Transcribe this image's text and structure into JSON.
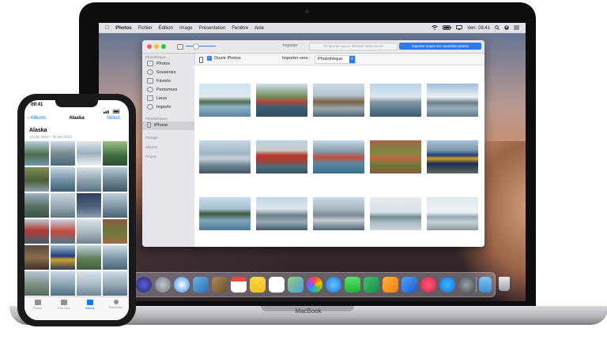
{
  "macbook": {
    "brand_label": "MacBook",
    "menubar": {
      "apple": "",
      "items": [
        "Photos",
        "Fichier",
        "Édition",
        "Image",
        "Présentation",
        "Fenêtre",
        "Aide"
      ],
      "clock": "Ven. 09:41"
    },
    "window": {
      "toolbar": {
        "import_title": "Importer",
        "import_selected_label": "N'importer aucun élément sélectionné",
        "import_all_label": "Importer toutes les nouvelles photos"
      },
      "subbar": {
        "open_photos_label": "Ouvrir Photos",
        "import_to_label": "Importer vers :",
        "import_to_value": "Photothèque"
      },
      "sidebar": {
        "library_header": "Photothèque",
        "library_items": [
          "Photos",
          "Souvenirs",
          "Favoris",
          "Personnes",
          "Lieux",
          "Imports"
        ],
        "devices_header": "Périphériques",
        "device_item": "iPhone",
        "shared_header": "Partagé",
        "albums_header": "Albums",
        "projects_header": "Projets"
      }
    }
  },
  "iphone": {
    "time": "09:41",
    "nav": {
      "back_label": "Albums",
      "title": "Alaska",
      "select_label": "Sélect."
    },
    "album": {
      "title": "Alaska",
      "date_range": "12 juin 2012 – 20 juin 2012"
    },
    "tabs": [
      "Photos",
      "Pour vous",
      "Albums",
      "Recherche"
    ],
    "active_tab": "Albums"
  },
  "colors": {
    "accent_blue": "#2d7bf4",
    "ios_blue": "#007aff",
    "sidebar_bg": "#e6e6ea"
  }
}
